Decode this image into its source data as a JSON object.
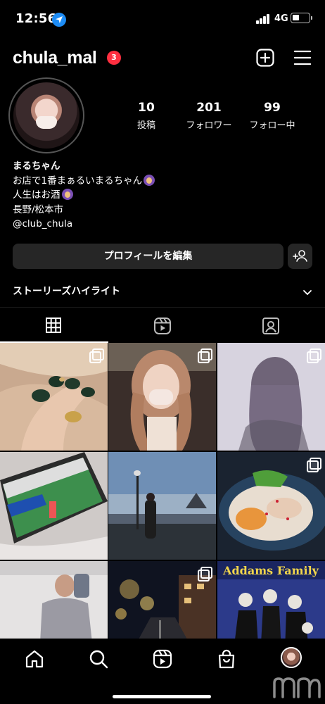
{
  "status_bar": {
    "time": "12:56",
    "network": "4G",
    "battery_level": 0.45
  },
  "header": {
    "username": "chula_mal",
    "notification_count": "3"
  },
  "profile": {
    "stats": [
      {
        "value": "10",
        "label": "投稿"
      },
      {
        "value": "201",
        "label": "フォロワー"
      },
      {
        "value": "99",
        "label": "フォロー中"
      }
    ],
    "bio": {
      "name": "まるちゃん",
      "line1": "お店で1番まぁるいまるちゃん",
      "line2": "人生はお酒",
      "line3": "長野/松本市",
      "line4": "@club_chula"
    }
  },
  "actions": {
    "edit_profile": "プロフィールを編集"
  },
  "highlights": {
    "label": "ストーリーズハイライト"
  },
  "tabs": [
    {
      "name": "grid",
      "icon": "grid-icon",
      "active": true
    },
    {
      "name": "reels",
      "icon": "reels-icon",
      "active": false
    },
    {
      "name": "tagged",
      "icon": "tagged-icon",
      "active": false
    }
  ],
  "posts": [
    {
      "subject": "nails",
      "multi": true
    },
    {
      "subject": "selfie",
      "multi": true
    },
    {
      "subject": "hair",
      "multi": true
    },
    {
      "subject": "soccer-tablet",
      "multi": false
    },
    {
      "subject": "night-castle",
      "multi": false
    },
    {
      "subject": "food",
      "multi": true
    },
    {
      "subject": "mirror-selfie",
      "multi": false
    },
    {
      "subject": "night-street",
      "multi": true
    },
    {
      "subject": "addams-family",
      "multi": false
    }
  ],
  "overlay_text": {
    "addams_title": "Addams Family"
  },
  "bottom_nav": [
    {
      "icon": "home-icon"
    },
    {
      "icon": "search-icon"
    },
    {
      "icon": "reels-icon"
    },
    {
      "icon": "shop-icon"
    },
    {
      "icon": "profile-avatar"
    }
  ],
  "colors": {
    "background": "#000000",
    "button_bg": "#262626",
    "badge": "#ff2f40",
    "location": "#1d8cf5"
  }
}
